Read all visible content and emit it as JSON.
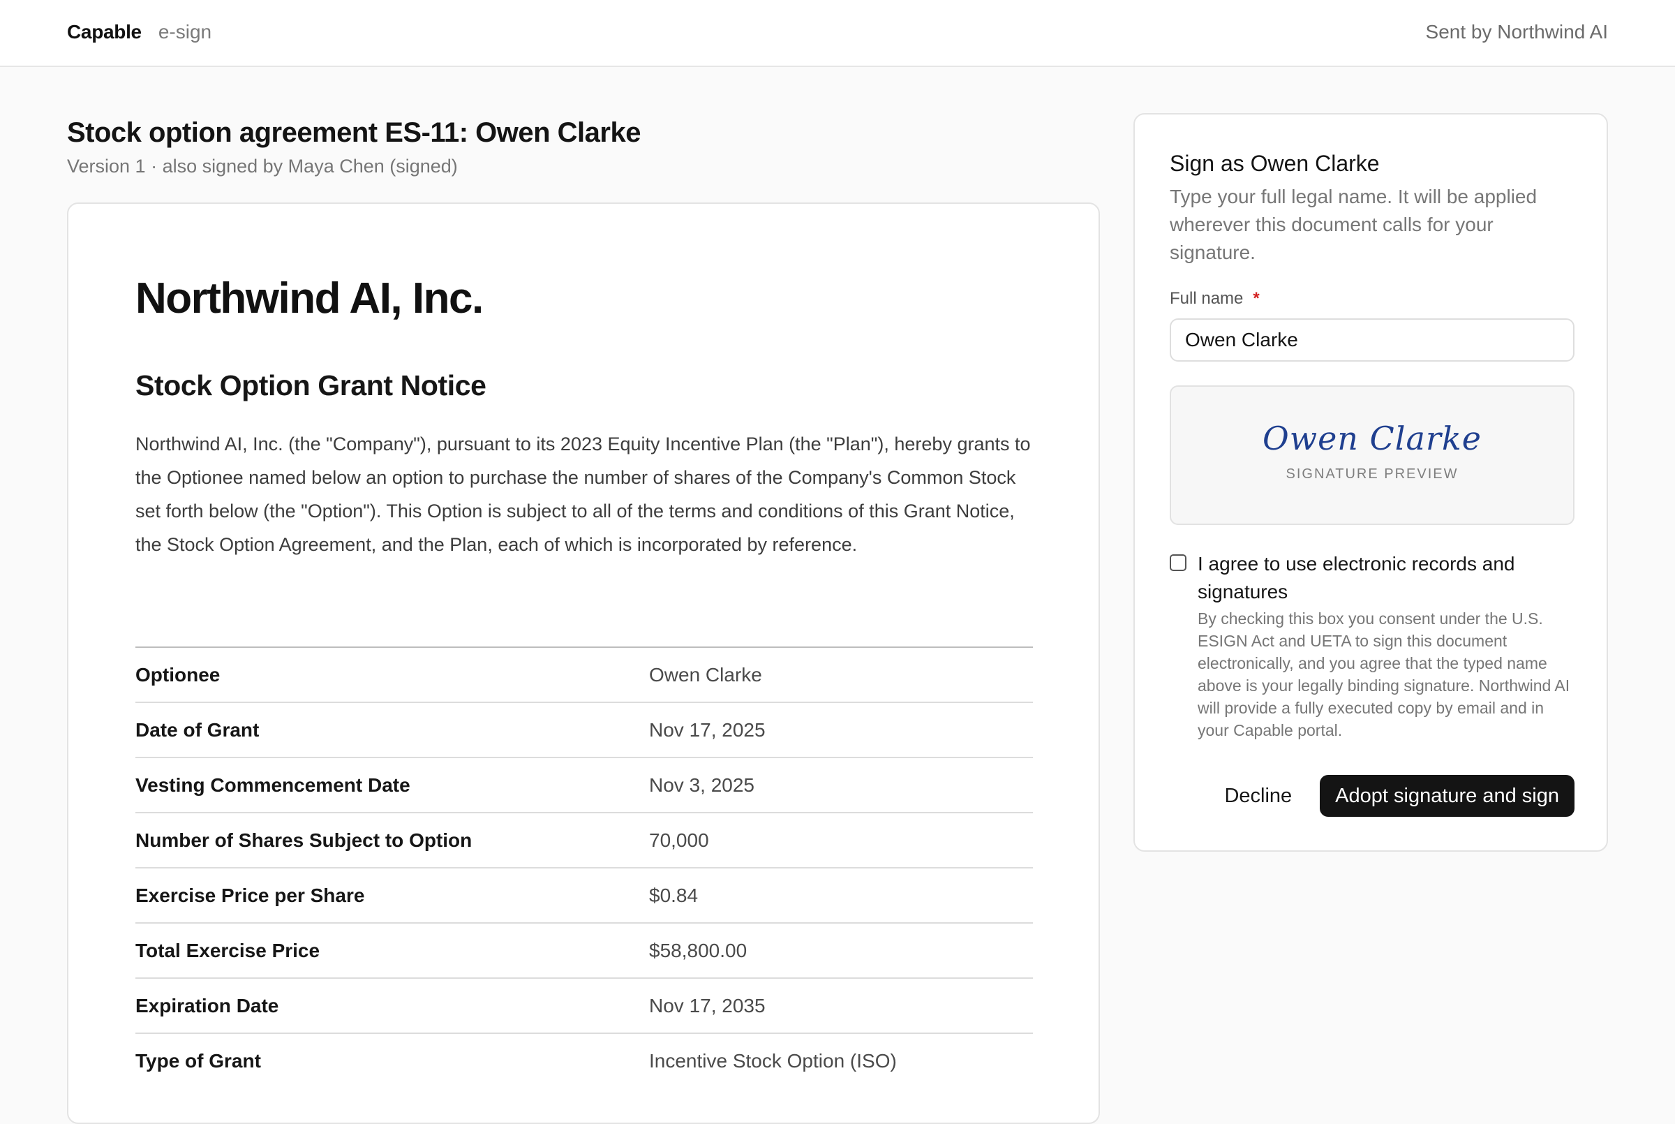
{
  "header": {
    "brand_name": "Capable",
    "brand_product": "e-sign",
    "sender": "Sent by Northwind AI"
  },
  "document": {
    "title": "Stock option agreement ES-11: Owen Clarke",
    "subtitle": "Version 1 · also signed by Maya Chen (signed)",
    "company": "Northwind AI, Inc.",
    "notice_title": "Stock Option Grant Notice",
    "intro": "Northwind AI, Inc. (the \"Company\"), pursuant to its 2023 Equity Incentive Plan (the \"Plan\"), hereby grants to the Optionee named below an option to purchase the number of shares of the Company's Common Stock set forth below (the \"Option\"). This Option is subject to all of the terms and conditions of this Grant Notice, the Stock Option Agreement, and the Plan, each of which is incorporated by reference.",
    "terms": [
      {
        "label": "Optionee",
        "value": "Owen Clarke"
      },
      {
        "label": "Date of Grant",
        "value": "Nov 17, 2025"
      },
      {
        "label": "Vesting Commencement Date",
        "value": "Nov 3, 2025"
      },
      {
        "label": "Number of Shares Subject to Option",
        "value": "70,000"
      },
      {
        "label": "Exercise Price per Share",
        "value": "$0.84"
      },
      {
        "label": "Total Exercise Price",
        "value": "$58,800.00"
      },
      {
        "label": "Expiration Date",
        "value": "Nov 17, 2035"
      },
      {
        "label": "Type of Grant",
        "value": "Incentive Stock Option (ISO)"
      }
    ]
  },
  "sign_panel": {
    "title": "Sign as Owen Clarke",
    "description": "Type your full legal name. It will be applied wherever this document calls for your signature.",
    "field_label": "Full name",
    "required_marker": "*",
    "full_name_value": "Owen Clarke",
    "signature_preview_text": "Owen Clarke",
    "signature_caption": "SIGNATURE PREVIEW",
    "consent_label": "I agree to use electronic records and signatures",
    "consent_checked": false,
    "consent_detail": "By checking this box you consent under the U.S. ESIGN Act and UETA to sign this document electronically, and you agree that the typed name above is your legally binding signature. Northwind AI will provide a fully executed copy by email and in your Capable portal.",
    "decline_label": "Decline",
    "adopt_label": "Adopt signature and sign"
  },
  "colors": {
    "page_background": "#fafafa",
    "primary_button": "#141414",
    "signature_ink": "#1f3f8f",
    "required": "#d32020"
  }
}
